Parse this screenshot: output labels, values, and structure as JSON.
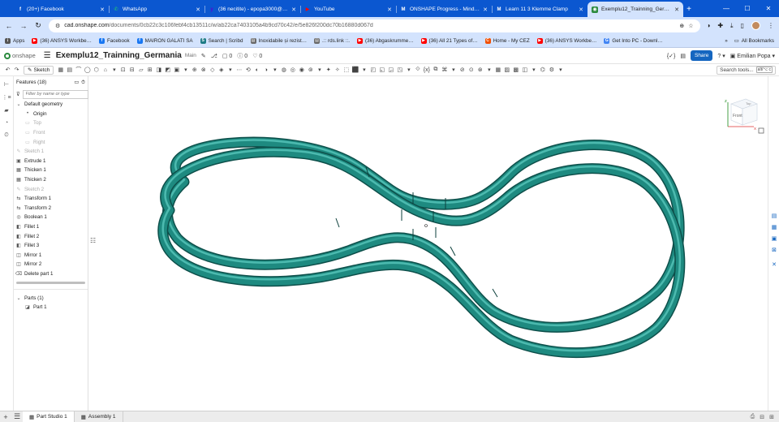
{
  "browser": {
    "tabs": [
      {
        "title": "(20+) Facebook",
        "icon": "facebook-icon",
        "color": "#ffffff",
        "glyph": "f"
      },
      {
        "title": "WhatsApp",
        "icon": "whatsapp-icon",
        "color": "#25d366",
        "glyph": "✆"
      },
      {
        "title": "(36 necitite) - epopa3000@yah…",
        "icon": "yahoo-mail-icon",
        "color": "#6001d2",
        "glyph": "y"
      },
      {
        "title": "YouTube",
        "icon": "youtube-icon",
        "color": "#ff0000",
        "glyph": "▶"
      },
      {
        "title": "ONSHAPE Progress - Mind Lu…",
        "icon": "miro-icon",
        "color": "#ffffff",
        "glyph": "M"
      },
      {
        "title": "Learn 11 3 Klemme Clamp",
        "icon": "miro-icon",
        "color": "#ffffff",
        "glyph": "M"
      },
      {
        "title": "Exemplu12_Trainning_Germania",
        "icon": "onshape-icon",
        "color": "#2b8a3e",
        "glyph": "◉"
      }
    ],
    "url_domain": "cad.onshape.com",
    "url_path": "/documents/0cb22c3c106febf4cb13511c/w/ab22ca7403105a4b9cd70c42/e/5e826f200dc70b16880d067d",
    "bookmarks": [
      {
        "label": "Apps",
        "icon": "apps-grid-icon",
        "color": "#555555",
        "glyph": "⋮"
      },
      {
        "label": "(36) ANSYS Workbe…",
        "icon": "youtube-icon",
        "color": "#ff0000",
        "glyph": "▶"
      },
      {
        "label": "Facebook",
        "icon": "facebook-icon",
        "color": "#1877f2",
        "glyph": "f"
      },
      {
        "label": "MAIRON GALATI SA",
        "icon": "facebook-icon",
        "color": "#1877f2",
        "glyph": "f"
      },
      {
        "label": "Search | Scribd",
        "icon": "scribd-icon",
        "color": "#1e7b85",
        "glyph": "S"
      },
      {
        "label": "Inoxidabile și rezist…",
        "icon": "page-icon",
        "color": "#6b6b6b",
        "glyph": "▤"
      },
      {
        "label": ".:: rds.link ::.",
        "icon": "page-icon",
        "color": "#6b6b6b",
        "glyph": "▤"
      },
      {
        "label": "(36) Abgaskrumme…",
        "icon": "youtube-icon",
        "color": "#ff0000",
        "glyph": "▶"
      },
      {
        "label": "(36) All 21 Types of…",
        "icon": "youtube-icon",
        "color": "#ff0000",
        "glyph": "▶"
      },
      {
        "label": "Home - My CEZ",
        "icon": "cez-icon",
        "color": "#f24f00",
        "glyph": "C"
      },
      {
        "label": "(36) ANSYS Workbe…",
        "icon": "youtube-icon",
        "color": "#ff0000",
        "glyph": "▶"
      },
      {
        "label": "Get Into PC - Downl…",
        "icon": "google-icon",
        "color": "#4285f4",
        "glyph": "G"
      }
    ],
    "all_bookmarks": "All Bookmarks"
  },
  "onshape": {
    "logo": "onshape",
    "document_name": "Exemplu12_Trainning_Germania",
    "branch": "Main",
    "counts": {
      "versions": "0",
      "info": "0",
      "likes": "0"
    },
    "share_label": "Share",
    "user_name": "Emilian Popa",
    "help_label": "?",
    "sketch_label": "Sketch",
    "search_tools_placeholder": "Search tools...",
    "search_tools_shortcut": "alt/⌥ c",
    "view_cube_label": "Front",
    "view_cube_top": "Top"
  },
  "features": {
    "header": "Features (18)",
    "filter_placeholder": "Filter by name or type",
    "default_geometry": "Default geometry",
    "default_items": [
      {
        "label": "Origin",
        "dim": false,
        "icon": "origin-icon",
        "glyph": "•"
      },
      {
        "label": "Top",
        "dim": true,
        "icon": "plane-icon",
        "glyph": "▭"
      },
      {
        "label": "Front",
        "dim": true,
        "icon": "plane-icon",
        "glyph": "▭"
      },
      {
        "label": "Right",
        "dim": true,
        "icon": "plane-icon",
        "glyph": "▭"
      }
    ],
    "items": [
      {
        "label": "Sketch 1",
        "dim": true,
        "icon": "sketch-icon",
        "glyph": "✎"
      },
      {
        "label": "Extrude 1",
        "dim": false,
        "icon": "extrude-icon",
        "glyph": "▣"
      },
      {
        "label": "Thicken 1",
        "dim": false,
        "icon": "thicken-icon",
        "glyph": "▦"
      },
      {
        "label": "Thicken 2",
        "dim": false,
        "icon": "thicken-icon",
        "glyph": "▦"
      },
      {
        "label": "Sketch 2",
        "dim": true,
        "icon": "sketch-icon",
        "glyph": "✎"
      },
      {
        "label": "Transform 1",
        "dim": false,
        "icon": "transform-icon",
        "glyph": "⇆"
      },
      {
        "label": "Transform 2",
        "dim": false,
        "icon": "transform-icon",
        "glyph": "⇆"
      },
      {
        "label": "Boolean 1",
        "dim": false,
        "icon": "boolean-icon",
        "glyph": "◎"
      },
      {
        "label": "Fillet 1",
        "dim": false,
        "icon": "fillet-icon",
        "glyph": "◧"
      },
      {
        "label": "Fillet 2",
        "dim": false,
        "icon": "fillet-icon",
        "glyph": "◧"
      },
      {
        "label": "Fillet 3",
        "dim": false,
        "icon": "fillet-icon",
        "glyph": "◧"
      },
      {
        "label": "Mirror 1",
        "dim": false,
        "icon": "mirror-icon",
        "glyph": "◫"
      },
      {
        "label": "Mirror 2",
        "dim": false,
        "icon": "mirror-icon",
        "glyph": "◫"
      },
      {
        "label": "Delete part 1",
        "dim": false,
        "icon": "delete-part-icon",
        "glyph": "⌫"
      }
    ],
    "parts_header": "Parts (1)",
    "parts": [
      {
        "label": "Part 1",
        "icon": "part-icon",
        "glyph": "◪"
      }
    ]
  },
  "bottom_tabs": [
    {
      "label": "Part Studio 1",
      "icon": "part-studio-icon",
      "glyph": "▦",
      "active": true
    },
    {
      "label": "Assembly 1",
      "icon": "assembly-icon",
      "glyph": "▦",
      "active": false
    }
  ],
  "model": {
    "color": "#1e8a80",
    "highlight": "#48b8ad",
    "shadow": "#0d4f4a"
  }
}
